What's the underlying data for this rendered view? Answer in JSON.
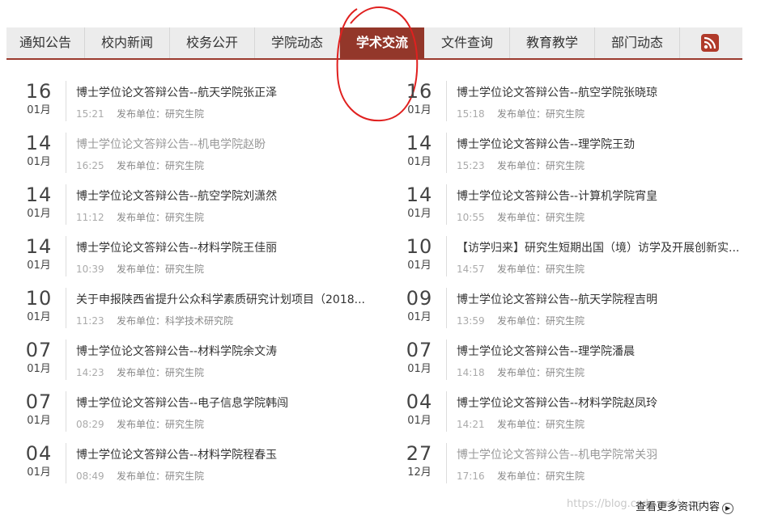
{
  "tabs": [
    {
      "label": "通知公告",
      "active": false
    },
    {
      "label": "校内新闻",
      "active": false
    },
    {
      "label": "校务公开",
      "active": false
    },
    {
      "label": "学院动态",
      "active": false
    },
    {
      "label": "学术交流",
      "active": true
    },
    {
      "label": "文件查询",
      "active": false
    },
    {
      "label": "教育教学",
      "active": false
    },
    {
      "label": "部门动态",
      "active": false
    }
  ],
  "rss_icon": "rss-icon",
  "left_items": [
    {
      "day": "16",
      "month": "01月",
      "title": "博士学位论文答辩公告--航天学院张正泽",
      "time": "15:21",
      "unit": "发布单位：研究生院",
      "visited": false
    },
    {
      "day": "14",
      "month": "01月",
      "title": "博士学位论文答辩公告--机电学院赵盼",
      "time": "16:25",
      "unit": "发布单位：研究生院",
      "visited": true
    },
    {
      "day": "14",
      "month": "01月",
      "title": "博士学位论文答辩公告--航空学院刘潇然",
      "time": "11:12",
      "unit": "发布单位：研究生院",
      "visited": false
    },
    {
      "day": "14",
      "month": "01月",
      "title": "博士学位论文答辩公告--材料学院王佳丽",
      "time": "10:39",
      "unit": "发布单位：研究生院",
      "visited": false
    },
    {
      "day": "10",
      "month": "01月",
      "title": "关于申报陕西省提升公众科学素质研究计划项目（2018...",
      "time": "11:23",
      "unit": "发布单位：科学技术研究院",
      "visited": false
    },
    {
      "day": "07",
      "month": "01月",
      "title": "博士学位论文答辩公告--材料学院余文涛",
      "time": "14:23",
      "unit": "发布单位：研究生院",
      "visited": false
    },
    {
      "day": "07",
      "month": "01月",
      "title": "博士学位论文答辩公告--电子信息学院韩闯",
      "time": "08:29",
      "unit": "发布单位：研究生院",
      "visited": false
    },
    {
      "day": "04",
      "month": "01月",
      "title": "博士学位论文答辩公告--材料学院程春玉",
      "time": "08:49",
      "unit": "发布单位：研究生院",
      "visited": false
    }
  ],
  "right_items": [
    {
      "day": "16",
      "month": "01月",
      "title": "博士学位论文答辩公告--航空学院张晓琼",
      "time": "15:18",
      "unit": "发布单位：研究生院",
      "visited": false
    },
    {
      "day": "14",
      "month": "01月",
      "title": "博士学位论文答辩公告--理学院王劲",
      "time": "15:23",
      "unit": "发布单位：研究生院",
      "visited": false
    },
    {
      "day": "14",
      "month": "01月",
      "title": "博士学位论文答辩公告--计算机学院宵皇",
      "time": "10:55",
      "unit": "发布单位：研究生院",
      "visited": false
    },
    {
      "day": "10",
      "month": "01月",
      "title": "【访学归来】研究生短期出国（境）访学及开展创新实...",
      "time": "14:57",
      "unit": "发布单位：研究生院",
      "visited": false
    },
    {
      "day": "09",
      "month": "01月",
      "title": "博士学位论文答辩公告--航天学院程吉明",
      "time": "13:59",
      "unit": "发布单位：研究生院",
      "visited": false
    },
    {
      "day": "07",
      "month": "01月",
      "title": "博士学位论文答辩公告--理学院潘晨",
      "time": "14:18",
      "unit": "发布单位：研究生院",
      "visited": false
    },
    {
      "day": "04",
      "month": "01月",
      "title": "博士学位论文答辩公告--材料学院赵凤玲",
      "time": "14:21",
      "unit": "发布单位：研究生院",
      "visited": false
    },
    {
      "day": "27",
      "month": "12月",
      "title": "博士学位论文答辩公告--机电学院常关羽",
      "time": "17:16",
      "unit": "发布单位：研究生院",
      "visited": true
    }
  ],
  "more_label": "查看更多资讯内容",
  "watermark": "https://blog.csdn.net/...peng",
  "colors": {
    "accent": "#93372a",
    "tabbar": "#ececec",
    "annotation": "#e0201f"
  }
}
